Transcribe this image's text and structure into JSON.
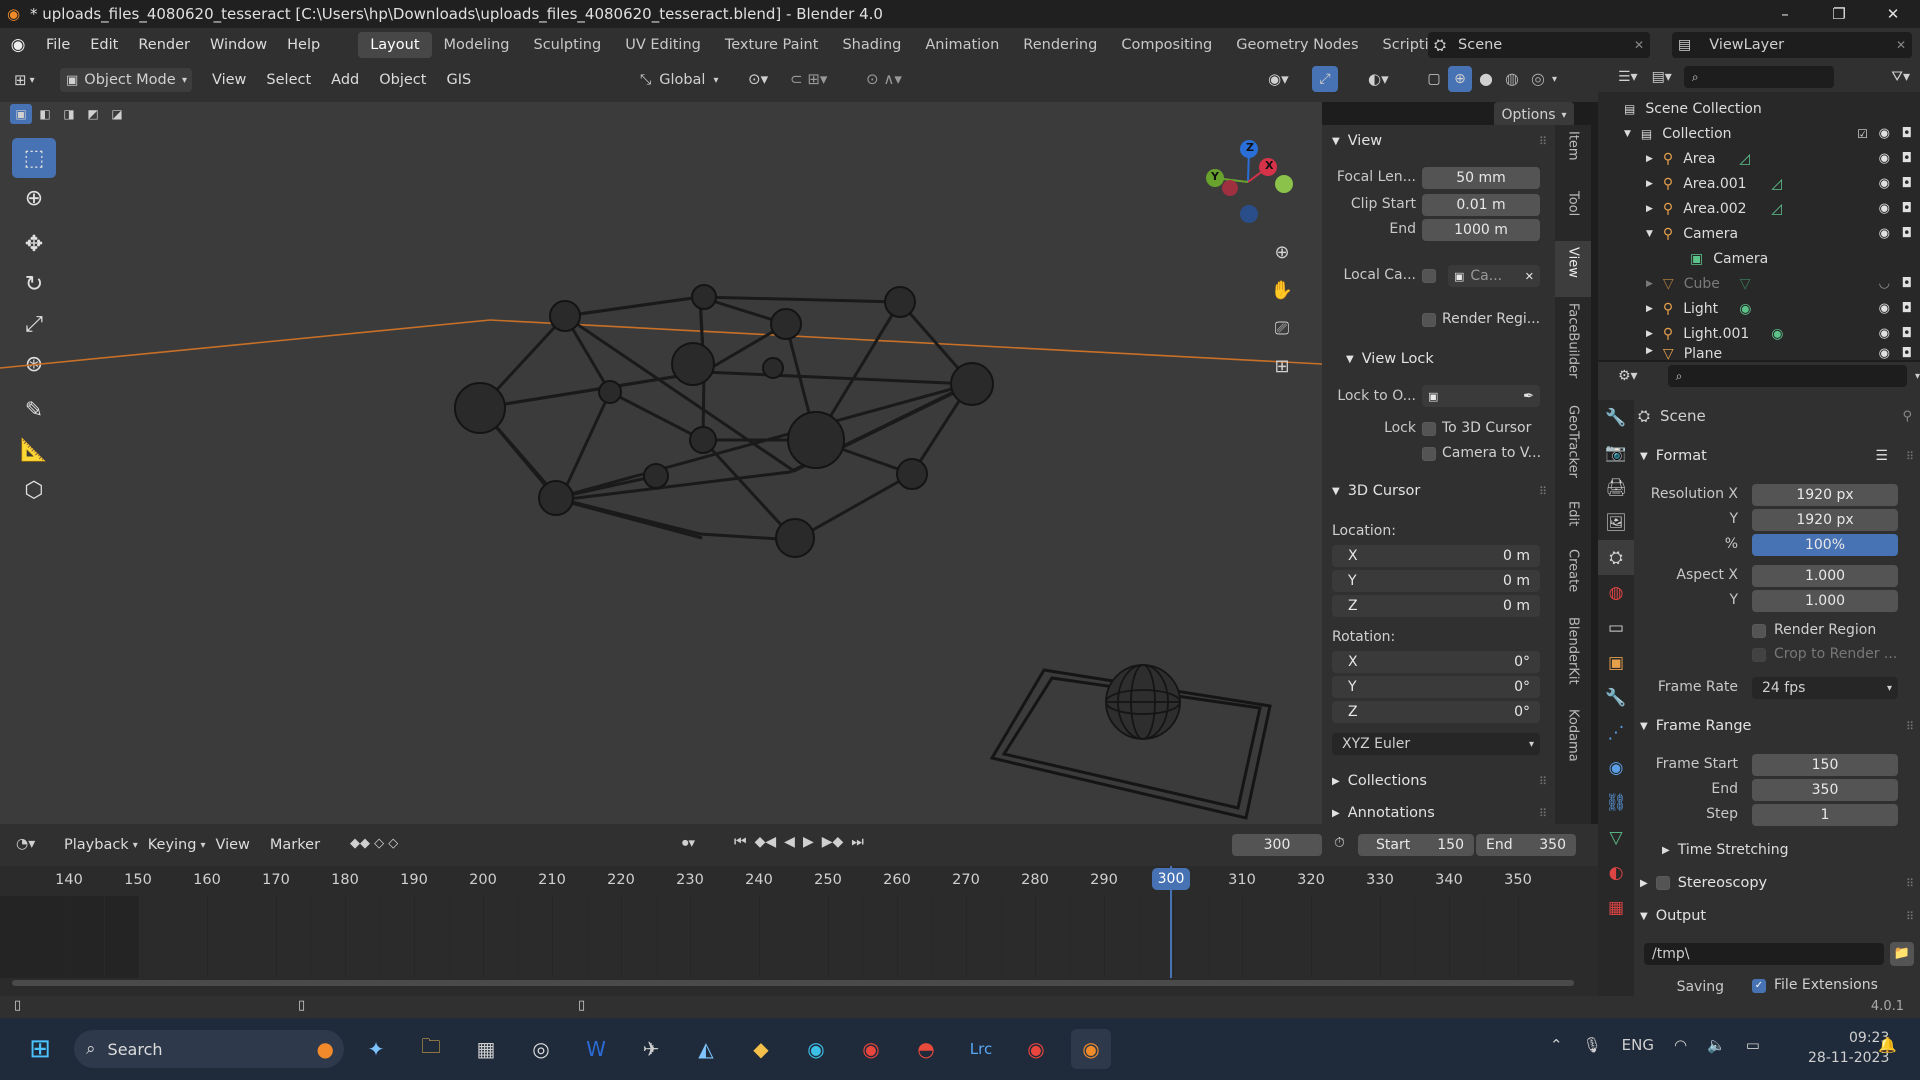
{
  "window": {
    "title": "* uploads_files_4080620_tesseract [C:\\Users\\hp\\Downloads\\uploads_files_4080620_tesseract.blend] - Blender 4.0",
    "minimize": "–",
    "maximize": "❐",
    "close": "✕"
  },
  "menus": [
    "File",
    "Edit",
    "Render",
    "Window",
    "Help"
  ],
  "workspaces": [
    "Layout",
    "Modeling",
    "Sculpting",
    "UV Editing",
    "Texture Paint",
    "Shading",
    "Animation",
    "Rendering",
    "Compositing",
    "Geometry Nodes",
    "Scripting"
  ],
  "workspace_add": "+",
  "scene_name": "Scene",
  "view_layer": "ViewLayer",
  "viewport_header": {
    "mode": "Object Mode",
    "menus": [
      "View",
      "Select",
      "Add",
      "Object",
      "GIS"
    ],
    "transform_orientation": "Global",
    "options": "Options"
  },
  "npanel": {
    "view_section": "View",
    "focal_label": "Focal Len...",
    "focal_value": "50 mm",
    "clip_start_label": "Clip Start",
    "clip_start_value": "0.01 m",
    "clip_end_label": "End",
    "clip_end_value": "1000 m",
    "local_camera_label": "Local Ca...",
    "local_camera_value": "Ca...",
    "render_region": "Render Regi...",
    "view_lock_section": "View Lock",
    "lock_to_label": "Lock to O...",
    "lock_label": "Lock",
    "to_3d_cursor": "To 3D Cursor",
    "camera_to_view": "Camera to V...",
    "cursor_section": "3D Cursor",
    "location_label": "Location:",
    "loc_x": "0 m",
    "loc_y": "0 m",
    "loc_z": "0 m",
    "rotation_label": "Rotation:",
    "rot_x": "0°",
    "rot_y": "0°",
    "rot_z": "0°",
    "rotation_mode": "XYZ Euler",
    "collections": "Collections",
    "annotations": "Annotations",
    "axis_x": "X",
    "axis_y": "Y",
    "axis_z": "Z"
  },
  "ntabs": [
    "Item",
    "Tool",
    "View",
    "FaceBuilder",
    "GeoTracker",
    "Edit",
    "Create",
    "BlenderKit",
    "Kodama"
  ],
  "outliner": {
    "scene_collection": "Scene Collection",
    "collection": "Collection",
    "items": [
      {
        "name": "Area",
        "dim": false
      },
      {
        "name": "Area.001",
        "dim": false
      },
      {
        "name": "Area.002",
        "dim": false
      },
      {
        "name": "Camera",
        "dim": false
      },
      {
        "name": "Camera",
        "dim": false
      },
      {
        "name": "Cube",
        "dim": true
      },
      {
        "name": "Light",
        "dim": false
      },
      {
        "name": "Light.001",
        "dim": false
      },
      {
        "name": "Plane",
        "dim": false
      }
    ]
  },
  "properties": {
    "context": "Scene",
    "format_section": "Format",
    "res_x_label": "Resolution X",
    "res_x": "1920 px",
    "res_y_label": "Y",
    "res_y": "1920 px",
    "pct_label": "%",
    "pct": "100%",
    "aspect_x_label": "Aspect X",
    "aspect_x": "1.000",
    "aspect_y_label": "Y",
    "aspect_y": "1.000",
    "render_region": "Render Region",
    "crop_to_render": "Crop to Render ...",
    "frame_rate_label": "Frame Rate",
    "frame_rate": "24 fps",
    "frame_range_section": "Frame Range",
    "frame_start_label": "Frame Start",
    "frame_start": "150",
    "end_label": "End",
    "end": "350",
    "step_label": "Step",
    "step": "1",
    "time_stretching": "Time Stretching",
    "stereoscopy": "Stereoscopy",
    "output_section": "Output",
    "output_path": "/tmp\\",
    "saving_label": "Saving",
    "file_extensions": "File Extensions"
  },
  "timeline": {
    "menus": [
      "Playback",
      "Keying",
      "View",
      "Marker"
    ],
    "current_frame": "300",
    "start_label": "Start",
    "start": "150",
    "end_label": "End",
    "end": "350",
    "ticks": [
      "140",
      "150",
      "160",
      "170",
      "180",
      "190",
      "200",
      "210",
      "220",
      "230",
      "240",
      "250",
      "260",
      "270",
      "280",
      "290",
      "300",
      "310",
      "320",
      "330",
      "340",
      "350"
    ],
    "playhead_label": "300"
  },
  "status": {
    "version": "4.0.1"
  },
  "taskbar": {
    "search": "Search",
    "lang": "ENG",
    "time": "09:23",
    "date": "28-11-2023"
  }
}
